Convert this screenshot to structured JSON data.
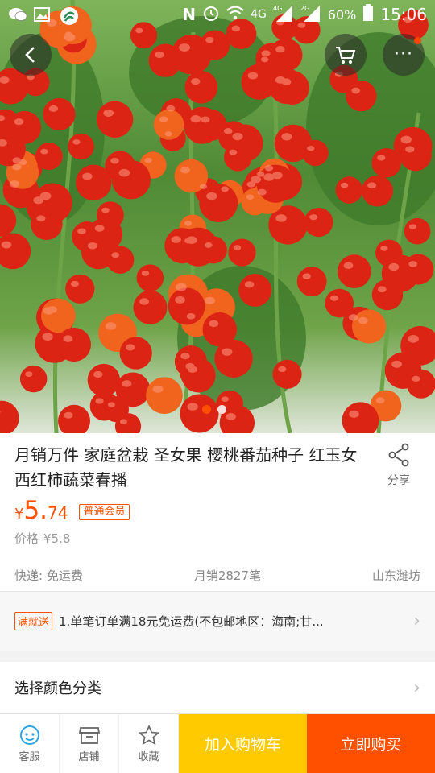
{
  "status_bar": {
    "network1": "4G",
    "network2": "4G",
    "network3": "2G",
    "battery": "60%",
    "time": "15:06"
  },
  "hero": {
    "slide_count": 2,
    "active_slide": 1
  },
  "product": {
    "title": "月销万件 家庭盆栽 圣女果 樱桃番茄种子 红玉女西红柿蔬菜春播",
    "share_label": "分享",
    "price_currency": "¥",
    "price_int": "5.",
    "price_dec": "74",
    "member_badge": "普通会员",
    "orig_label": "价格",
    "orig_price": "¥5.8",
    "shipping": "快递: 免运费",
    "monthly_sales": "月销2827笔",
    "location": "山东潍坊"
  },
  "promo": {
    "tag": "满就送",
    "text": "1.单笔订单满18元免运费(不包邮地区：海南;甘..."
  },
  "select_row": {
    "label": "选择颜色分类"
  },
  "bottom_bar": {
    "service": "客服",
    "shop": "店铺",
    "favorite": "收藏",
    "add_to_cart": "加入购物车",
    "buy_now": "立即购买"
  },
  "colors": {
    "accent": "#ff5000",
    "cart_yellow": "#ffcb00"
  }
}
